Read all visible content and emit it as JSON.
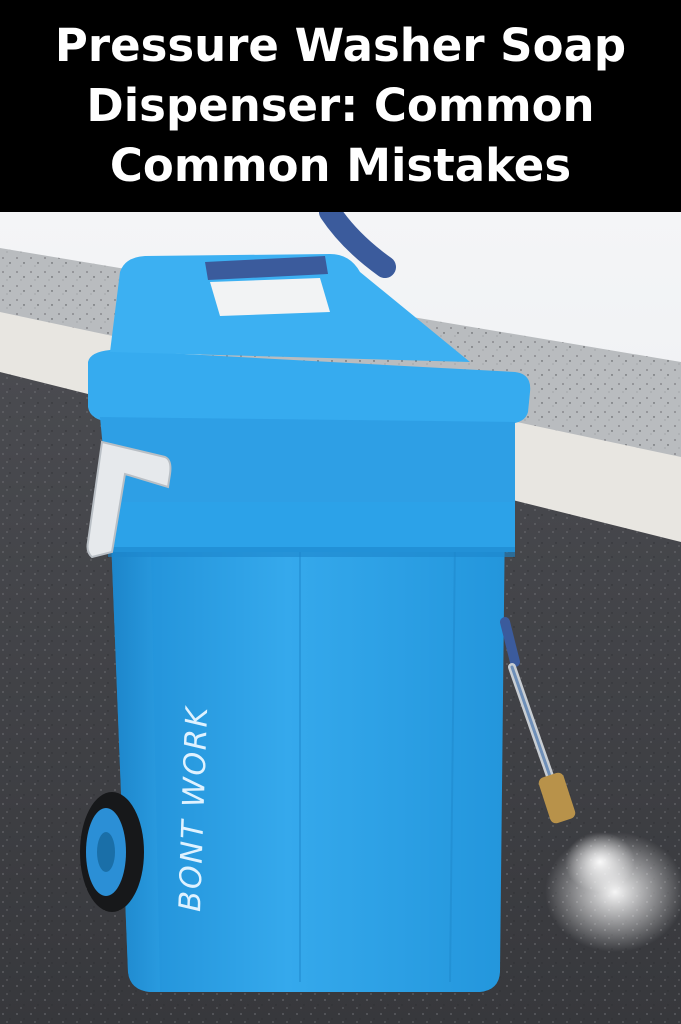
{
  "banner": {
    "title": "Pressure Washer Soap Dispenser: Common Common Mistakes"
  },
  "photo": {
    "product_brand_text": "BONT WORK",
    "colors": {
      "bin_blue": "#2fa3e6",
      "handle_navy": "#3b5b9c",
      "asphalt": "#3f4044",
      "wall": "#f1f3f5",
      "clip_gray": "#e6e9ec",
      "brass": "#b8924a"
    }
  }
}
